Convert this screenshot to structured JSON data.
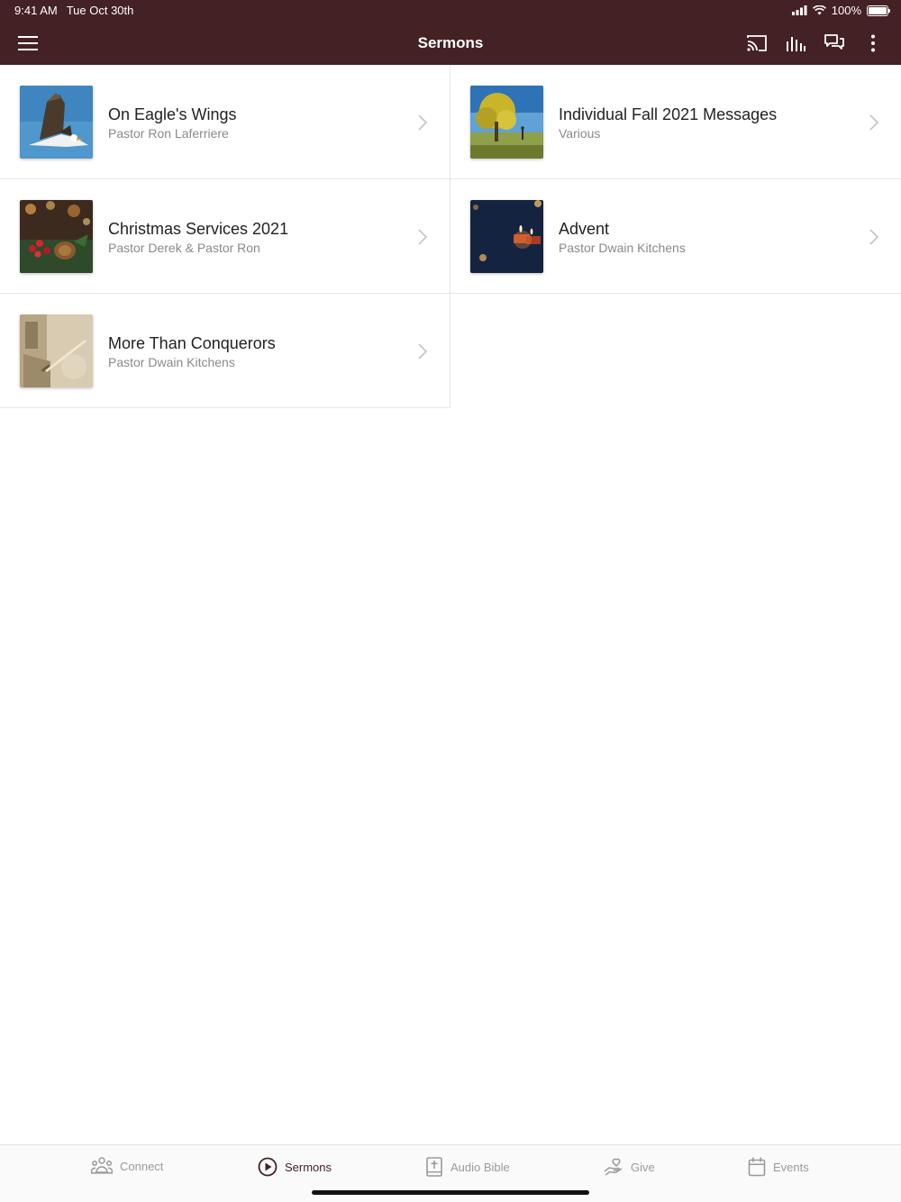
{
  "status_bar": {
    "time": "9:41 AM",
    "date": "Tue Oct 30th",
    "battery": "100%",
    "battery_level": 1.0
  },
  "nav": {
    "title": "Sermons",
    "icons": [
      "menu-icon",
      "cast-icon",
      "audio-bars-icon",
      "chat-icon",
      "more-vertical-icon"
    ]
  },
  "sermons": [
    {
      "title": "On Eagle's Wings",
      "subtitle": "Pastor Ron Laferriere",
      "thumbnail": "eagle-thumbnail"
    },
    {
      "title": "Individual Fall 2021 Messages",
      "subtitle": "Various",
      "thumbnail": "fall-tree-thumbnail"
    },
    {
      "title": "Christmas Services 2021",
      "subtitle": "Pastor Derek & Pastor Ron",
      "thumbnail": "christmas-thumbnail"
    },
    {
      "title": "Advent",
      "subtitle": "Pastor Dwain Kitchens",
      "thumbnail": "candles-thumbnail"
    },
    {
      "title": "More Than Conquerors",
      "subtitle": "Pastor Dwain Kitchens",
      "thumbnail": "sword-thumbnail"
    }
  ],
  "tabs": [
    {
      "label": "Connect",
      "icon": "people-icon",
      "active": false
    },
    {
      "label": "Sermons",
      "icon": "play-circle-icon",
      "active": true
    },
    {
      "label": "Audio Bible",
      "icon": "bible-icon",
      "active": false
    },
    {
      "label": "Give",
      "icon": "give-hand-icon",
      "active": false
    },
    {
      "label": "Events",
      "icon": "calendar-icon",
      "active": false
    }
  ],
  "colors": {
    "header_bg": "#442125",
    "active_tab": "#442125",
    "inactive_tab": "#9a9a9a",
    "subtitle": "#8a8a8a"
  }
}
